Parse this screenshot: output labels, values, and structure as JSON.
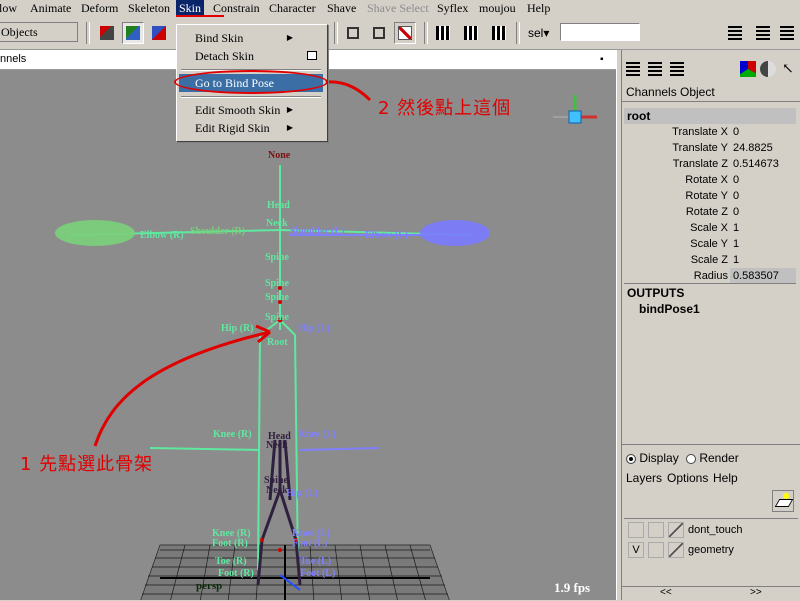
{
  "menubar": {
    "items": [
      "low",
      "Animate",
      "Deform",
      "Skeleton",
      "Skin",
      "Constrain",
      "Character",
      "Shave",
      "Shave Select",
      "Syflex",
      "moujou",
      "Help"
    ]
  },
  "toolbar": {
    "mode_field": "Objects",
    "sel_field": "sel▾"
  },
  "viewport": {
    "header_label": "nnels",
    "camera_label": "persp",
    "fps": "1.9 fps",
    "joint_labels": {
      "none": "None",
      "head": "Head",
      "neck": "Neck",
      "spine": "Spine",
      "hip_r": "Hip (R)",
      "hip_l": "Hip (L)",
      "root": "Root",
      "shoulder_r": "Shoulder (R)",
      "shoulder_l": "Shoulder (L)",
      "collar_r": "Collar (R)",
      "collar_l": "Collar (L)",
      "elbow_r": "Elbow (R)",
      "elbow_l": "Elbow (L)",
      "knee_r": "Knee (R)",
      "knee_l": "Knee (L)",
      "foot_r": "Foot (R)",
      "foot_l": "Foot (L)",
      "toe_r": "Toe (R)",
      "toe_l": "Toe (L)"
    }
  },
  "skin_menu": {
    "items": [
      {
        "label": "Bind Skin",
        "submenu": true
      },
      {
        "label": "Detach Skin",
        "option": true
      },
      {
        "label": "Go to Bind Pose",
        "highlighted": true
      },
      {
        "label": "Edit Smooth Skin",
        "submenu": true
      },
      {
        "label": "Edit Rigid Skin",
        "submenu": true
      }
    ]
  },
  "annotations": {
    "step1": "1 先點選此骨架",
    "step2": "2 然後點上這個"
  },
  "channel_box": {
    "tabs": [
      "Channels",
      "Object"
    ],
    "node_name": "root",
    "rows": [
      {
        "label": "Translate X",
        "value": "0"
      },
      {
        "label": "Translate Y",
        "value": "24.8825"
      },
      {
        "label": "Translate Z",
        "value": "0.514673"
      },
      {
        "label": "Rotate X",
        "value": "0"
      },
      {
        "label": "Rotate Y",
        "value": "0"
      },
      {
        "label": "Rotate Z",
        "value": "0"
      },
      {
        "label": "Scale X",
        "value": "1"
      },
      {
        "label": "Scale Y",
        "value": "1"
      },
      {
        "label": "Scale Z",
        "value": "1"
      },
      {
        "label": "Radius",
        "value": "0.583507"
      }
    ],
    "outputs_header": "OUTPUTS",
    "outputs_item": "bindPose1"
  },
  "layer_editor": {
    "display_label": "Display",
    "render_label": "Render",
    "menu": [
      "Layers",
      "Options",
      "Help"
    ],
    "layers": [
      {
        "v": "",
        "name": "dont_touch"
      },
      {
        "v": "V",
        "name": "geometry"
      }
    ],
    "scroll_left": "<<",
    "scroll_right": ">>"
  },
  "colors": {
    "annotation_red": "#e00000",
    "highlight_blue": "#3a6ea5",
    "joint_green": "#5fe8a0",
    "joint_blue": "#8080ff"
  }
}
